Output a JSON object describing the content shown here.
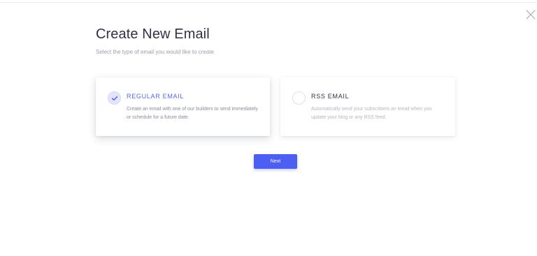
{
  "header": {
    "title": "Create New Email",
    "subtitle": "Select the type of email you would like to create"
  },
  "options": [
    {
      "title": "REGULAR EMAIL",
      "description": "Create an email with one of our builders to send immediately or schedule for a future date.",
      "selected": true
    },
    {
      "title": "RSS EMAIL",
      "description": "Automatically send your subscribers an email when you update your blog or any RSS feed.",
      "selected": false
    }
  ],
  "actions": {
    "next_label": "Next"
  },
  "colors": {
    "accent": "#4d5ef2",
    "selected_title": "#5567e9",
    "heading": "#2f3147",
    "muted_text": "#9aa0ac"
  },
  "icons": {
    "close": "close-icon",
    "check": "check-icon"
  }
}
